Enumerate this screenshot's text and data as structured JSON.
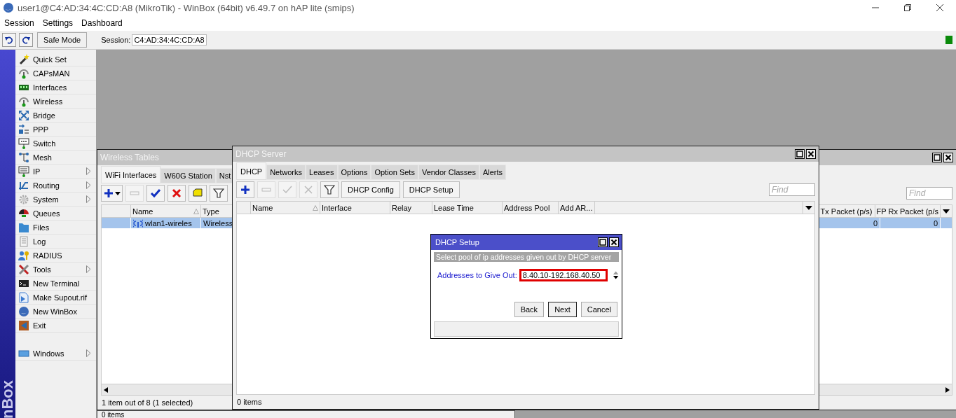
{
  "window": {
    "title": "user1@C4:AD:34:4C:CD:A8 (MikroTik) - WinBox (64bit) v6.49.7 on hAP lite (smips)"
  },
  "menu": [
    "Session",
    "Settings",
    "Dashboard"
  ],
  "toolbar": {
    "safe_mode": "Safe Mode",
    "session_label": "Session:",
    "session_value": "C4:AD:34:4C:CD:A8"
  },
  "side_strip": {
    "text": "nBox"
  },
  "sidebar": {
    "items": [
      {
        "label": "Quick Set",
        "submenu": false
      },
      {
        "label": "CAPsMAN",
        "submenu": false
      },
      {
        "label": "Interfaces",
        "submenu": false
      },
      {
        "label": "Wireless",
        "submenu": false
      },
      {
        "label": "Bridge",
        "submenu": false
      },
      {
        "label": "PPP",
        "submenu": false
      },
      {
        "label": "Switch",
        "submenu": false
      },
      {
        "label": "Mesh",
        "submenu": false
      },
      {
        "label": "IP",
        "submenu": true
      },
      {
        "label": "Routing",
        "submenu": true
      },
      {
        "label": "System",
        "submenu": true
      },
      {
        "label": "Queues",
        "submenu": false
      },
      {
        "label": "Files",
        "submenu": false
      },
      {
        "label": "Log",
        "submenu": false
      },
      {
        "label": "RADIUS",
        "submenu": false
      },
      {
        "label": "Tools",
        "submenu": true
      },
      {
        "label": "New Terminal",
        "submenu": false
      },
      {
        "label": "Make Supout.rif",
        "submenu": false
      },
      {
        "label": "New WinBox",
        "submenu": false
      },
      {
        "label": "Exit",
        "submenu": false
      }
    ],
    "bottom_items": [
      {
        "label": "Windows",
        "submenu": true
      }
    ]
  },
  "wireless_window": {
    "title": "Wireless Tables",
    "tabs": [
      {
        "label": "WiFi Interfaces",
        "selected": true
      },
      {
        "label": "W60G Station",
        "selected": false
      },
      {
        "label": "Nst",
        "selected": false
      }
    ],
    "tools": [
      {
        "kind": "add",
        "disabled": false
      },
      {
        "kind": "remove",
        "disabled": true
      },
      {
        "kind": "enable",
        "disabled": false
      },
      {
        "kind": "disable",
        "disabled": false
      },
      {
        "kind": "comment",
        "disabled": false
      },
      {
        "kind": "filter",
        "disabled": false
      }
    ],
    "find_placeholder": "Find",
    "columns": [
      {
        "label": "Name",
        "sorted": true
      },
      {
        "label": "Type",
        "sorted": false
      }
    ],
    "right_columns": [
      {
        "label": "Tx Packet (p/s)"
      },
      {
        "label": "FP Rx Packet (p/s"
      }
    ],
    "rows": [
      {
        "selected": true,
        "name": "wlan1-wireles",
        "type": "Wireless",
        "tx_packet": "0",
        "fp_rx_packet": "0"
      }
    ],
    "status": "1 item out of 8 (1 selected)"
  },
  "back_window": {
    "status": "0 items"
  },
  "dhcp_window": {
    "title": "DHCP Server",
    "tabs": [
      {
        "label": "DHCP",
        "selected": true
      },
      {
        "label": "Networks",
        "selected": false
      },
      {
        "label": "Leases",
        "selected": false
      },
      {
        "label": "Options",
        "selected": false
      },
      {
        "label": "Option Sets",
        "selected": false
      },
      {
        "label": "Vendor Classes",
        "selected": false
      },
      {
        "label": "Alerts",
        "selected": false
      }
    ],
    "tools": [
      {
        "kind": "add",
        "disabled": false
      },
      {
        "kind": "remove",
        "disabled": true
      },
      {
        "kind": "enable",
        "disabled": true
      },
      {
        "kind": "disable",
        "disabled": true
      },
      {
        "kind": "filter",
        "disabled": false
      }
    ],
    "text_buttons": [
      "DHCP Config",
      "DHCP Setup"
    ],
    "find_placeholder": "Find",
    "columns": [
      {
        "label": "Name",
        "sorted": true
      },
      {
        "label": "Interface",
        "sorted": false
      },
      {
        "label": "Relay",
        "sorted": false
      },
      {
        "label": "Lease Time",
        "sorted": false
      },
      {
        "label": "Address Pool",
        "sorted": false
      },
      {
        "label": "Add AR...",
        "sorted": false
      }
    ],
    "status": "0 items"
  },
  "setup_dialog": {
    "title": "DHCP Setup",
    "heading": "Select pool of ip addresses given out by DHCP server",
    "field": {
      "label": "Addresses to Give Out:",
      "value": "8.40.10-192.168.40.50",
      "highlighted": true
    },
    "buttons": [
      {
        "label": "Back",
        "default": false
      },
      {
        "label": "Next",
        "default": true
      },
      {
        "label": "Cancel",
        "default": false
      }
    ]
  }
}
